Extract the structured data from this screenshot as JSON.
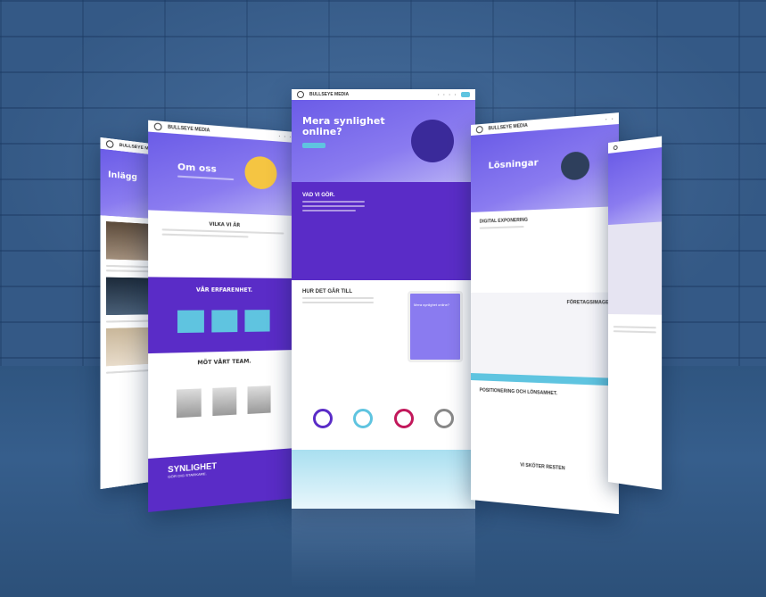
{
  "brand": {
    "name": "BULLSEYE MEDIA"
  },
  "colors": {
    "wall": "#3c6391",
    "purple": "#5a2cc7",
    "violet": "#6b5ce7",
    "cyan": "#5fc4e0"
  },
  "far_left": {
    "title": "Inlägg"
  },
  "left": {
    "hero_title": "Om oss",
    "section1": "VILKA VI ÄR",
    "section2": "VÅR ERFARENHET.",
    "section3": "MÖT VÅRT TEAM.",
    "banner_title": "SYNLIGHET",
    "banner_sub": "GÖR DIG STARKARE."
  },
  "center": {
    "hero_title_line1": "Mera synlighet",
    "hero_title_line2": "online?",
    "section1": "VAD VI GÖR.",
    "section2": "HUR DET GÅR TILL",
    "tablet_title": "Mera synlighet online?"
  },
  "right": {
    "hero_title": "Lösningar",
    "section1": "DIGITAL EXPONERING",
    "section2": "FÖRETAGSIMAGE",
    "section3": "POSITIONERING OCH LÖNSAMHET.",
    "section4": "VI SKÖTER RESTEN"
  }
}
